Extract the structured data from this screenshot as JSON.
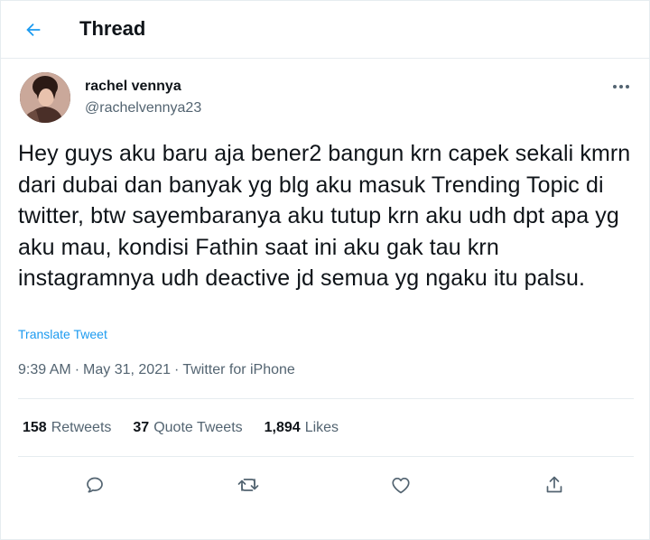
{
  "header": {
    "title": "Thread",
    "back_icon": "arrow-left-icon"
  },
  "user": {
    "display_name": "rachel vennya",
    "handle": "@rachelvennya23",
    "more_icon": "more-horizontal-icon"
  },
  "tweet": {
    "text": "Hey guys aku baru aja bener2 bangun krn capek sekali kmrn dari dubai dan banyak yg blg aku masuk Trending Topic di twitter, btw sayembaranya aku tutup krn aku udh dpt apa yg aku mau, kondisi Fathin saat ini aku gak tau krn instagramnya udh deactive jd semua yg ngaku itu palsu.",
    "translate_label": "Translate Tweet",
    "time": "9:39 AM",
    "date": "May 31, 2021",
    "source": "Twitter for iPhone",
    "separator": "·"
  },
  "stats": {
    "retweets_count": "158",
    "retweets_label": "Retweets",
    "quotes_count": "37",
    "quotes_label": "Quote Tweets",
    "likes_count": "1,894",
    "likes_label": "Likes"
  },
  "actions": [
    "reply-icon",
    "retweet-icon",
    "like-icon",
    "share-icon"
  ],
  "colors": {
    "accent": "#1d9bf0",
    "text": "#0f1419",
    "secondary": "#536471",
    "border": "#e6ecf0"
  }
}
